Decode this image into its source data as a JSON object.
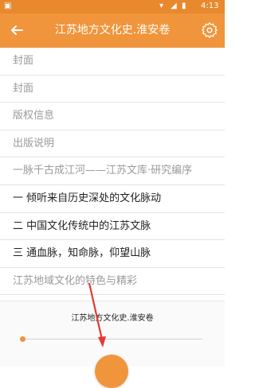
{
  "status_bar": {
    "time": "4:13"
  },
  "app_bar": {
    "title": "江苏地方文化史.淮安卷",
    "back_icon": "back-arrow-icon",
    "settings_icon": "gear-icon"
  },
  "toc": {
    "items": [
      {
        "label": "封面",
        "dark": false
      },
      {
        "label": "封面",
        "dark": false
      },
      {
        "label": "版权信息",
        "dark": false
      },
      {
        "label": "出版说明",
        "dark": false
      },
      {
        "label": "一脉千古成江河——江苏文库·研究编序",
        "dark": false
      },
      {
        "label": "一 倾听来自历史深处的文化脉动",
        "dark": true
      },
      {
        "label": "二 中国文化传统中的江苏文脉",
        "dark": true
      },
      {
        "label": "三 通血脉，知命脉，仰望山脉",
        "dark": true
      },
      {
        "label": "江苏地域文化的特色与精彩",
        "dark": false
      }
    ]
  },
  "bottom_panel": {
    "book_name": "江苏地方文化史.淮安卷",
    "progress": 0
  },
  "colors": {
    "accent": "#f0953c",
    "status_bar": "#e8892d",
    "annotation_arrow": "#e53935"
  }
}
